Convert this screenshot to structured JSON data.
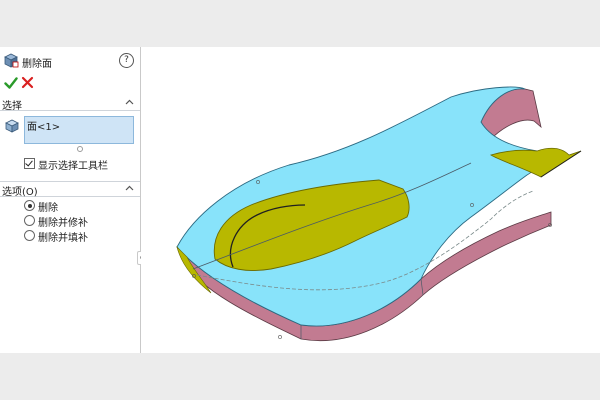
{
  "feature": {
    "title": "删除面",
    "icon": "delete-face-feature-icon",
    "help_icon": "help-icon",
    "help_label": "?"
  },
  "actions": {
    "ok_icon": "checkmark-icon",
    "cancel_icon": "close-icon",
    "ok_color": "#2a9a2a",
    "cancel_color": "#d92020"
  },
  "selection": {
    "section_label": "选择",
    "list_icon": "face-select-icon",
    "items": [
      "面<1>"
    ],
    "show_toolbar_label": "显示选择工具栏",
    "show_toolbar_checked": true
  },
  "options": {
    "section_label": "选项(O)",
    "choices": [
      {
        "label": "删除",
        "selected": true
      },
      {
        "label": "删除并修补",
        "selected": false
      },
      {
        "label": "删除并填补",
        "selected": false
      }
    ]
  },
  "colors": {
    "top_face": "#88e3fa",
    "side_face": "#c27b91",
    "selected_face": "#b8b800",
    "selection_box": "#cfe4f6"
  }
}
